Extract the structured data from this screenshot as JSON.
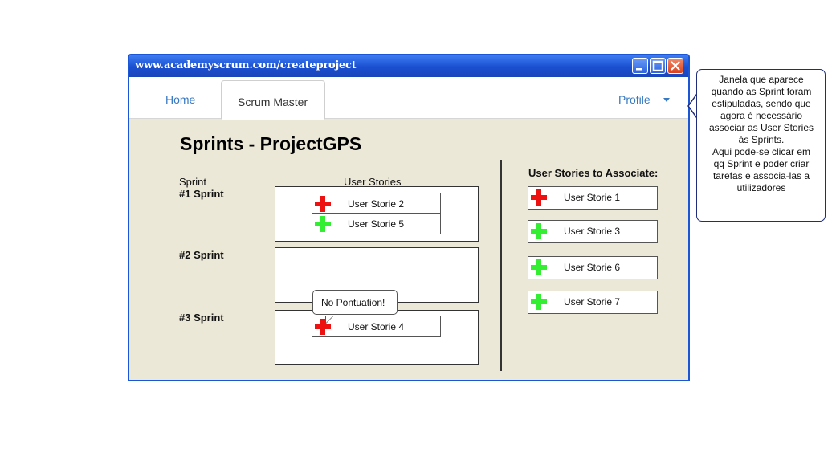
{
  "window": {
    "url": "www.academyscrum.com/createproject"
  },
  "nav": {
    "home": "Home",
    "active_tab": "Scrum Master",
    "profile": "Profile"
  },
  "page": {
    "title": "Sprints - ProjectGPS",
    "col_sprint": "Sprint",
    "col_user_stories": "User Stories",
    "sprints": [
      {
        "label": "#1 Sprint",
        "stories": [
          {
            "name": "User Storie 2",
            "icon": "red-plus-icon",
            "color": "#ee1111"
          },
          {
            "name": "User Storie 5",
            "icon": "green-plus-icon",
            "color": "#33ee33"
          }
        ]
      },
      {
        "label": "#2 Sprint",
        "stories": []
      },
      {
        "label": "#3 Sprint",
        "stories": [
          {
            "name": "User Storie 4",
            "icon": "red-plus-icon",
            "color": "#ee1111"
          }
        ]
      }
    ],
    "tooltip": "No Pontuation!",
    "associate_title": "User Stories to Associate:",
    "to_associate": [
      {
        "name": "User Storie 1",
        "icon": "red-plus-icon",
        "color": "#ee1111"
      },
      {
        "name": "User Storie 3",
        "icon": "green-plus-icon",
        "color": "#33ee33"
      },
      {
        "name": "User Storie 6",
        "icon": "green-plus-icon",
        "color": "#33ee33"
      },
      {
        "name": "User Storie 7",
        "icon": "green-plus-icon",
        "color": "#33ee33"
      }
    ]
  },
  "callout": {
    "lines": [
      "Janela que aparece",
      "quando as Sprint foram",
      "estipuladas, sendo que",
      "agora é necessário",
      "associar as User Stories",
      "às Sprints.",
      "Aqui pode-se clicar em",
      "qq Sprint e poder criar",
      "tarefas e associa-las a",
      "utilizadores"
    ]
  },
  "colors": {
    "titlebar": "#1a4fd0",
    "link": "#3678c2",
    "content_bg": "#ece8d8",
    "red_plus": "#ee1111",
    "green_plus": "#33ee33"
  }
}
